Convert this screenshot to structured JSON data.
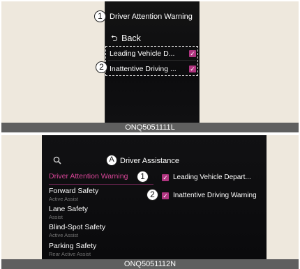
{
  "top_figure": {
    "callout_1": "1",
    "title": "Driver Attention Warning",
    "back_label": "Back",
    "back_arrow": "⮌",
    "items": [
      {
        "label": "Leading Vehicle D...",
        "checked": true
      },
      {
        "label": "Inattentive Driving ...",
        "checked": true
      }
    ],
    "callout_2": "2",
    "caption": "ONQ5051111L"
  },
  "bottom_figure": {
    "callout_a": "A",
    "title": "Driver Assistance",
    "search_icon": "search-icon",
    "menu": [
      {
        "label": "Driver Attention Warning",
        "sub": "",
        "active": true
      },
      {
        "label": "Forward Safety",
        "sub": "Active Assist",
        "active": false
      },
      {
        "label": "Lane Safety",
        "sub": "Assist",
        "active": false
      },
      {
        "label": "Blind-Spot Safety",
        "sub": "Active Assist",
        "active": false
      },
      {
        "label": "Parking Safety",
        "sub": "Rear Active Assist",
        "active": false
      }
    ],
    "callout_1": "1",
    "callout_2": "2",
    "settings": [
      {
        "label": "Leading Vehicle Depart...",
        "checked": true
      },
      {
        "label": "Inattentive Driving Warning",
        "checked": true
      }
    ],
    "caption": "ONQ5051112N"
  },
  "colors": {
    "accent": "#d74597",
    "checkbox": "#b03580",
    "screen_bg": "#0a0a0c",
    "frame_bg": "#eee8dd",
    "caption_bg": "#5f5f5f"
  }
}
